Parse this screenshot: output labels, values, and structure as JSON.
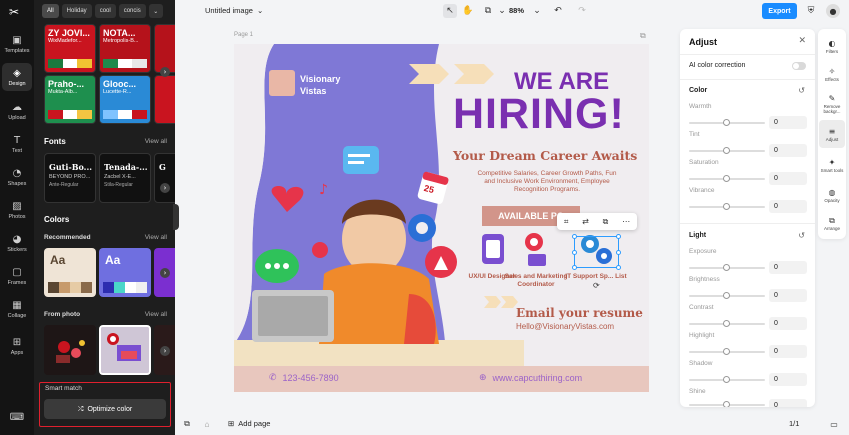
{
  "left_nav": {
    "items": [
      {
        "label": "Templates",
        "icon": "templates-icon"
      },
      {
        "label": "Design",
        "icon": "design-icon"
      },
      {
        "label": "Upload",
        "icon": "upload-icon"
      },
      {
        "label": "Text",
        "icon": "text-icon"
      },
      {
        "label": "Shapes",
        "icon": "shapes-icon"
      },
      {
        "label": "Photos",
        "icon": "photos-icon"
      },
      {
        "label": "Stickers",
        "icon": "stickers-icon"
      },
      {
        "label": "Frames",
        "icon": "frames-icon"
      },
      {
        "label": "Collage",
        "icon": "collage-icon"
      },
      {
        "label": "Apps",
        "icon": "apps-icon"
      }
    ],
    "active": "Design"
  },
  "design_panel": {
    "chips": [
      "All",
      "Holiday",
      "cool",
      "concis"
    ],
    "templates": [
      {
        "title": "ZY JOVI...",
        "sub": "WixMadefor...",
        "bg": "#c9141f",
        "fg": "#ffffff",
        "swatches": [
          "#1c7a3e",
          "#ffffff",
          "#f1c232"
        ]
      },
      {
        "title": "NOTA...",
        "sub": "Metropolis-B...",
        "bg": "#b5121b",
        "fg": "#ffffff",
        "swatches": [
          "#1f8a4c",
          "#ffffff",
          "#e8e8e8"
        ]
      },
      {
        "title": "Praho-...",
        "sub": "Mukta-Alb...",
        "bg": "#1e8f4e",
        "fg": "#ffffff",
        "swatches": [
          "#c9141f",
          "#ffffff",
          "#f4c542"
        ]
      },
      {
        "title": "Glooc...",
        "sub": "Lucette-R...",
        "bg": "#2a8ad6",
        "fg": "#ffffff",
        "swatches": [
          "#7fc3ff",
          "#ffffff",
          "#c9141f"
        ]
      }
    ],
    "fonts_title": "Fonts",
    "fonts_view_all": "View all",
    "fonts": [
      {
        "name": "Guti-Bo...",
        "sub": "BEYOND PRO...",
        "foot": "Ante-Regular"
      },
      {
        "name": "Tenada-...",
        "sub": "Zacbel X-E...",
        "foot": "Stila-Regular"
      }
    ],
    "colors_title": "Colors",
    "recommended_label": "Recommended",
    "recommended_view_all": "View all",
    "palettes": [
      {
        "label": "Aa",
        "bg": "#efe4d6",
        "fg": "#5a4632",
        "swatches": [
          "#5a4632",
          "#c79a6b",
          "#e6cba5",
          "#8a6a4a"
        ]
      },
      {
        "label": "Aa",
        "bg": "#6f6fe0",
        "fg": "#ffffff",
        "swatches": [
          "#2d2db0",
          "#4ad6c9",
          "#ffffff",
          "#f0f0f0"
        ]
      }
    ],
    "from_photo_label": "From photo",
    "from_photo_view_all": "View all",
    "smart_match_label": "Smart match",
    "optimize_button": "Optimize color"
  },
  "topbar": {
    "doc_title": "Untitled image",
    "zoom": "88%",
    "export_label": "Export"
  },
  "canvas": {
    "page_label": "Page 1",
    "company": "Visionary Vistas",
    "headline_1": "WE ARE",
    "headline_2": "HIRING!",
    "subheadline": "Your Dream Career Awaits",
    "description": "Competitive Salaries, Career Growth Paths, Fun and Inclusive Work Environment, Employee Recognition Programs.",
    "available": "AVAILABLE PO",
    "calendar_number": "25",
    "roles": [
      {
        "label": "UX/UI Designer",
        "color": "#7a2fb0"
      },
      {
        "label": "Sales and Marketing Coordinator",
        "color": "#c9141f"
      },
      {
        "label": "IT Support Sp... List",
        "color": "#2a8ad6"
      }
    ],
    "email_heading": "Email your resume",
    "email": "Hello@VisionaryVistas.com",
    "phone": "123-456-7890",
    "website": "www.capcuthiring.com"
  },
  "bottombar": {
    "add_page_label": "Add page",
    "page_counter": "1/1"
  },
  "adjust_panel": {
    "title": "Adjust",
    "ai_color_label": "AI color correction",
    "color_section": "Color",
    "color_sliders": [
      {
        "label": "Warmth",
        "value": "0"
      },
      {
        "label": "Tint",
        "value": "0"
      },
      {
        "label": "Saturation",
        "value": "0"
      },
      {
        "label": "Vibrance",
        "value": "0"
      }
    ],
    "light_section": "Light",
    "light_sliders": [
      {
        "label": "Exposure",
        "value": "0"
      },
      {
        "label": "Brightness",
        "value": "0"
      },
      {
        "label": "Contrast",
        "value": "0"
      },
      {
        "label": "Highlight",
        "value": "0"
      },
      {
        "label": "Shadow",
        "value": "0"
      },
      {
        "label": "Shine",
        "value": "0"
      }
    ]
  },
  "right_rail": {
    "items": [
      {
        "label": "Filters"
      },
      {
        "label": "Effects"
      },
      {
        "label": "Remove backgr..."
      },
      {
        "label": "Adjust"
      },
      {
        "label": "Smart tools"
      },
      {
        "label": "Opacity"
      },
      {
        "label": "Arrange"
      }
    ],
    "active": "Adjust"
  },
  "colors": {
    "accent": "#1a8cff",
    "headline": "#7a2fb0",
    "warm_text": "#b35a49",
    "highlight_border": "#e0202e"
  }
}
